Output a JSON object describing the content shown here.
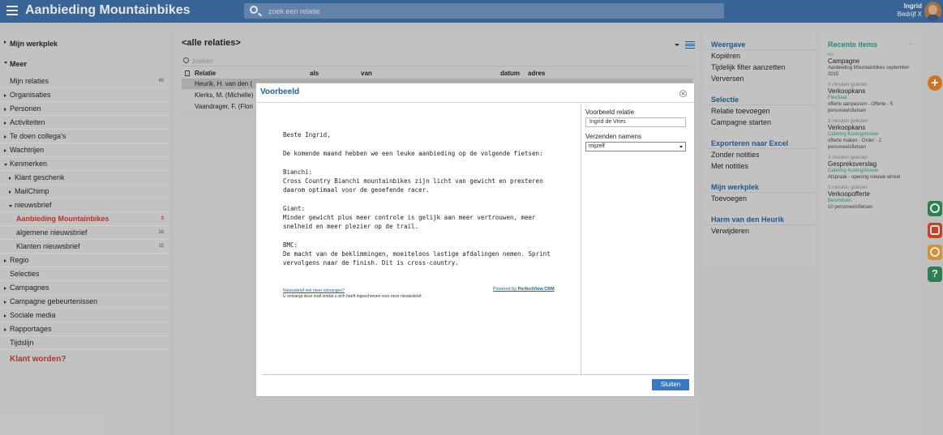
{
  "app": {
    "title": "Aanbieding Mountainbikes"
  },
  "search": {
    "placeholder": "zoek een relatie"
  },
  "user": {
    "name": "Ingrid",
    "company": "Bedrijf X"
  },
  "sidebar": {
    "sections": [
      {
        "label": "Mijn werkplek"
      },
      {
        "label": "Meer"
      }
    ],
    "items": [
      {
        "label": "Mijn relaties",
        "count": "49"
      },
      {
        "label": "Organisaties"
      },
      {
        "label": "Personen"
      },
      {
        "label": "Activiteiten"
      },
      {
        "label": "Te doen collega's"
      },
      {
        "label": "Wachtrijen"
      },
      {
        "label": "Kenmerken"
      },
      {
        "label": "Klant geschenk"
      },
      {
        "label": "MailChimp"
      },
      {
        "label": "nieuwsbrief"
      },
      {
        "label": "Aanbieding Mountainbikes",
        "count": "3"
      },
      {
        "label": "algemene nieuwsbrief",
        "count": "16"
      },
      {
        "label": "Klanten nieuwsbrief",
        "count": "15"
      },
      {
        "label": "Regio"
      },
      {
        "label": "Selecties"
      },
      {
        "label": "Campagnes"
      },
      {
        "label": "Campagne gebeurtenissen"
      },
      {
        "label": "Sociale media"
      },
      {
        "label": "Rapportages"
      },
      {
        "label": "Tijdslijn"
      }
    ],
    "cta": "Klant worden?"
  },
  "content": {
    "title": "<alle relaties>",
    "filter_placeholder": "zoeken",
    "columns": [
      "Relatie",
      "als",
      "van",
      "datum",
      "adres"
    ],
    "rows": [
      "Heurik, H. van den (",
      "Klerks, M. (Michelle)",
      "Vaandrager, F. (Flori"
    ]
  },
  "rpanel": {
    "groups": [
      {
        "title": "Weergave",
        "items": [
          "Kopiëren",
          "Tijdelijk filter aanzetten",
          "Verversen"
        ]
      },
      {
        "title": "Selectie",
        "items": [
          "Relatie toevoegen",
          "Campagne starten"
        ]
      },
      {
        "title": "Exporteren naar Excel",
        "items": [
          "Zonder notities",
          "Met notities"
        ]
      },
      {
        "title": "Mijn werkplek",
        "items": [
          "Toevoegen"
        ]
      },
      {
        "title": "Harm van den Heurik",
        "items": [
          "Verwijderen"
        ]
      }
    ]
  },
  "recent": {
    "title": "Recente items",
    "minimize": "-",
    "items": [
      {
        "time": "nu",
        "type": "Campagne",
        "company": "",
        "detail": "Aanbieding Mountainbikes september 2015"
      },
      {
        "time": "3 minuten geleden",
        "type": "Verkoopkans",
        "company": "FlexSeat",
        "detail": "offerte aanpassen - Offerte - 5 personeelsfietsen"
      },
      {
        "time": "3 minuten geleden",
        "type": "Verkoopkans",
        "company": "Catering Koningshoeve",
        "detail": "offerte maken - Order - 2 personeelsfietsen"
      },
      {
        "time": "3 minuten geleden",
        "type": "Gespreksverslag",
        "company": "Catering Koningshoeve",
        "detail": "Afspraak - opening nieuwe winkel"
      },
      {
        "time": "3 minuten geleden",
        "type": "Verkoopofferte",
        "company": "Berendsen",
        "detail": "10 personeelsfietsen"
      }
    ]
  },
  "modal": {
    "title": "Voorbeeld",
    "email": {
      "greeting": "Beste Ingrid,",
      "intro": "De komende maand hebben we een leuke aanbieding op de volgende fietsen:",
      "bikes": [
        {
          "name": "Bianchi:",
          "text": "Cross Country Bianchi mountainbikes zijn licht van gewicht en presteren daarom optimaal voor de geoefende racer."
        },
        {
          "name": "Giant:",
          "text": "Minder gewicht plus meer controle is gelijk aan meer vertrouwen, meer snelheid en meer plezier op de trail."
        },
        {
          "name": "BMC:",
          "text": "De macht van de beklimmingen, moeiteloos lastige afdalingen nemen. Sprint vervolgens naar de finish. Dit is cross-country."
        }
      ],
      "footer_link": "Nieuwsbrief niet meer ontvangen?",
      "footer_note": "U ontvangt deze mail omdat u zich heeft ingeschreven voor onze nieuwsbrief.",
      "powered_prefix": "Powered by",
      "powered_brand": "PerfectView CRM"
    },
    "preview_relation_label": "Voorbeeld relatie",
    "preview_relation_value": "Ingrid de Vries",
    "send_as_label": "Verzenden namens",
    "send_as_value": "mijzelf",
    "close_button": "Sluiten"
  },
  "colors": {
    "topbar": "#3b6ea5",
    "accent_blue": "#1f5fa0",
    "accent_red": "#c0392b",
    "accent_teal": "#2a9a86"
  }
}
